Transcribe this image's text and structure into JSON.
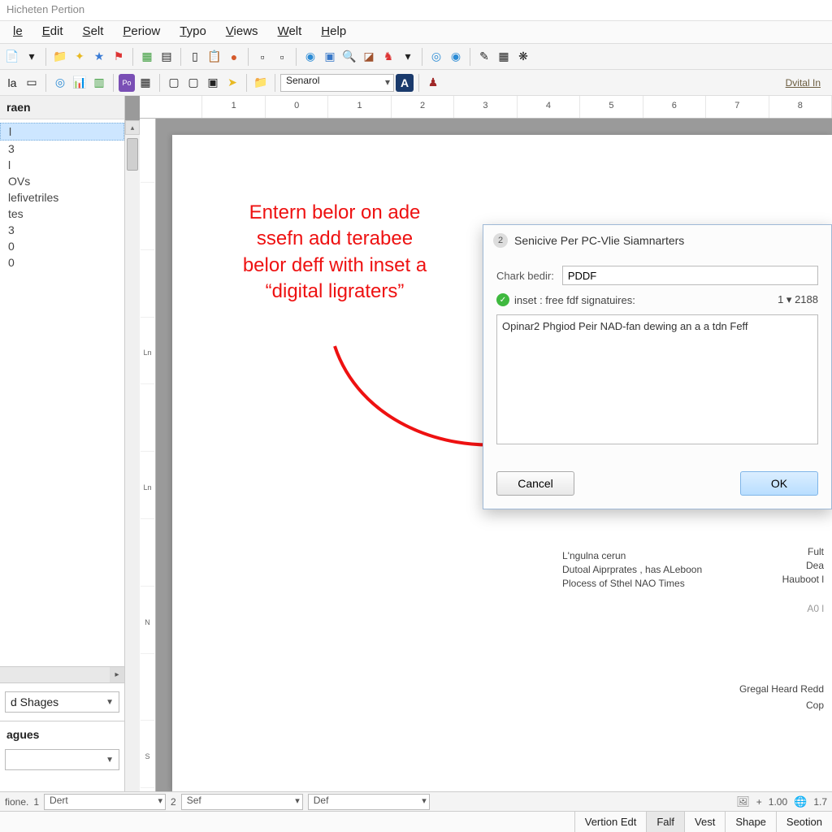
{
  "window": {
    "title": "Hicheten Pertion"
  },
  "menu": {
    "items": [
      "le",
      "Edit",
      "Selt",
      "Periow",
      "Typo",
      "Views",
      "Welt",
      "Help"
    ]
  },
  "toolbar1": {
    "dropdown_arrow": "▾"
  },
  "toolbar2": {
    "combo_label": "Senarol",
    "right_link": "Dvital In"
  },
  "sidebar": {
    "header": "raen",
    "items": [
      "l",
      "3",
      "l",
      "OVs",
      "lefivetriles",
      "tes",
      "3",
      "0",
      "0"
    ],
    "shapes_label": "d Shages",
    "pages_label": "agues"
  },
  "ruler_h": [
    "",
    "1",
    "0",
    "1",
    "2",
    "3",
    "4",
    "5",
    "6",
    "7",
    "8"
  ],
  "ruler_v": [
    "",
    "",
    "",
    "Ln",
    "",
    "Ln",
    "",
    "N",
    "",
    "S"
  ],
  "annotation": {
    "line1": "Entern belor on ade",
    "line2": "ssefn add terabee",
    "line3": "belor deff with inset a",
    "line4": "“digital ligraters”"
  },
  "dialog": {
    "step_num": "2",
    "title": "Senicive Per PC-Vlie Siamnarters",
    "field_label": "Chark bedir:",
    "field_value": "PDDF",
    "status_text": "inset : free fdf signatuires:",
    "status_count": "1 ▾ 2188",
    "textarea_value": "Opinar2 Phgiod Peir NAD-fan dewing an a a tdn Feff",
    "cancel": "Cancel",
    "ok": "OK"
  },
  "page_text": {
    "block1_l1": "L'ngulna cerun",
    "block1_l2": "Dutoal Aiprprates , has ALeboon",
    "block1_l3": "Plocess of Sthel NAO Times",
    "block2_l1": "Fult",
    "block2_l2": "Dea",
    "block2_l3": "Hauboot l",
    "block3": "A0 l",
    "block4": "Gregal Heard Redd",
    "block5": "Cop"
  },
  "bottombar": {
    "label1": "fione.",
    "num1": "1",
    "combo1": "Dert",
    "num2": "2",
    "combo2": "Sef",
    "combo3": "Def",
    "zoom_plus": "+",
    "zoom_val": "1.00",
    "zoom_b": "1.7"
  },
  "statusbar": {
    "tabs": [
      "Vertion Edt",
      "Falf",
      "Vest",
      "Shape",
      "Seotion"
    ],
    "active_index": 1
  }
}
